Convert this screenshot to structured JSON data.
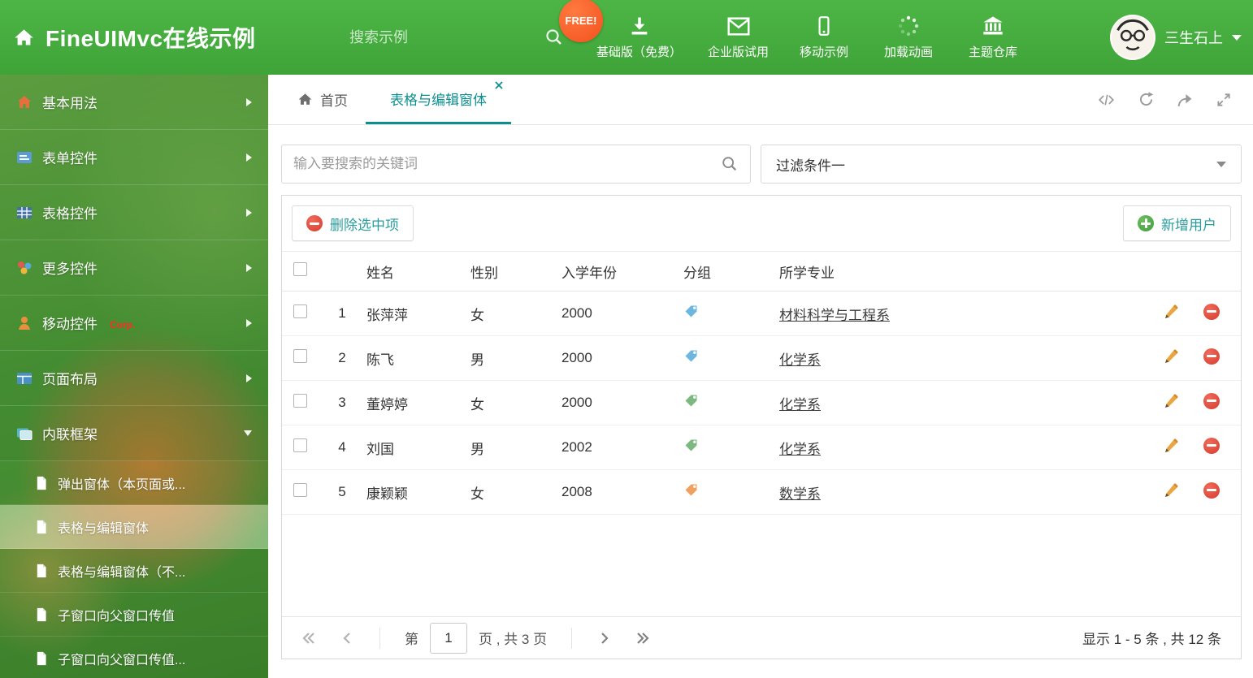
{
  "colors": {
    "header_green": "#47ab3f",
    "accent_teal": "#0e8f8f",
    "free_badge_orange": "#f4511e",
    "tag_blue": "#6cb6df",
    "tag_green": "#7cb980",
    "tag_orange": "#f0a05f",
    "delete_red": "#d63c2e",
    "add_green": "#3f9b43"
  },
  "header": {
    "title": "FineUIMvc在线示例",
    "search_placeholder": "搜索示例",
    "free_badge": "FREE!",
    "nav": [
      {
        "label": "基础版（免费）",
        "icon": "download-icon"
      },
      {
        "label": "企业版试用",
        "icon": "envelope-icon"
      },
      {
        "label": "移动示例",
        "icon": "mobile-icon"
      },
      {
        "label": "加载动画",
        "icon": "loading-spinner-icon"
      },
      {
        "label": "主题仓库",
        "icon": "bank-icon"
      }
    ],
    "user_name": "三生石上"
  },
  "sidebar": {
    "items": [
      {
        "label": "基本用法",
        "icon": "home-icon"
      },
      {
        "label": "表单控件",
        "icon": "form-icon"
      },
      {
        "label": "表格控件",
        "icon": "table-icon"
      },
      {
        "label": "更多控件",
        "icon": "widgets-icon"
      },
      {
        "label": "移动控件",
        "icon": "person-icon",
        "badge": "Corp."
      },
      {
        "label": "页面布局",
        "icon": "layout-icon"
      },
      {
        "label": "内联框架",
        "icon": "frame-icon",
        "expanded": true
      }
    ],
    "subitems": [
      {
        "label": "弹出窗体（本页面或..."
      },
      {
        "label": "表格与编辑窗体",
        "active": true
      },
      {
        "label": "表格与编辑窗体（不..."
      },
      {
        "label": "子窗口向父窗口传值"
      },
      {
        "label": "子窗口向父窗口传值..."
      }
    ]
  },
  "tabs": {
    "home_label": "首页",
    "active_label": "表格与编辑窗体"
  },
  "filter": {
    "search_placeholder": "输入要搜索的关键词",
    "filter_value": "过滤条件一"
  },
  "grid": {
    "toolbar": {
      "delete_label": "删除选中项",
      "add_label": "新增用户"
    },
    "columns": [
      "姓名",
      "性别",
      "入学年份",
      "分组",
      "所学专业"
    ],
    "rows": [
      {
        "index": "1",
        "name": "张萍萍",
        "gender": "女",
        "year": "2000",
        "tag": "blue",
        "major": "材料科学与工程系"
      },
      {
        "index": "2",
        "name": "陈飞",
        "gender": "男",
        "year": "2000",
        "tag": "blue",
        "major": "化学系"
      },
      {
        "index": "3",
        "name": "董婷婷",
        "gender": "女",
        "year": "2000",
        "tag": "green",
        "major": "化学系"
      },
      {
        "index": "4",
        "name": "刘国",
        "gender": "男",
        "year": "2002",
        "tag": "green",
        "major": "化学系"
      },
      {
        "index": "5",
        "name": "康颖颖",
        "gender": "女",
        "year": "2008",
        "tag": "orange",
        "major": "数学系"
      }
    ],
    "pagination": {
      "page_prefix": "第",
      "current_page": "1",
      "page_suffix": "页 , 共 3 页",
      "summary": "显示 1 - 5 条 , 共 12 条"
    }
  }
}
